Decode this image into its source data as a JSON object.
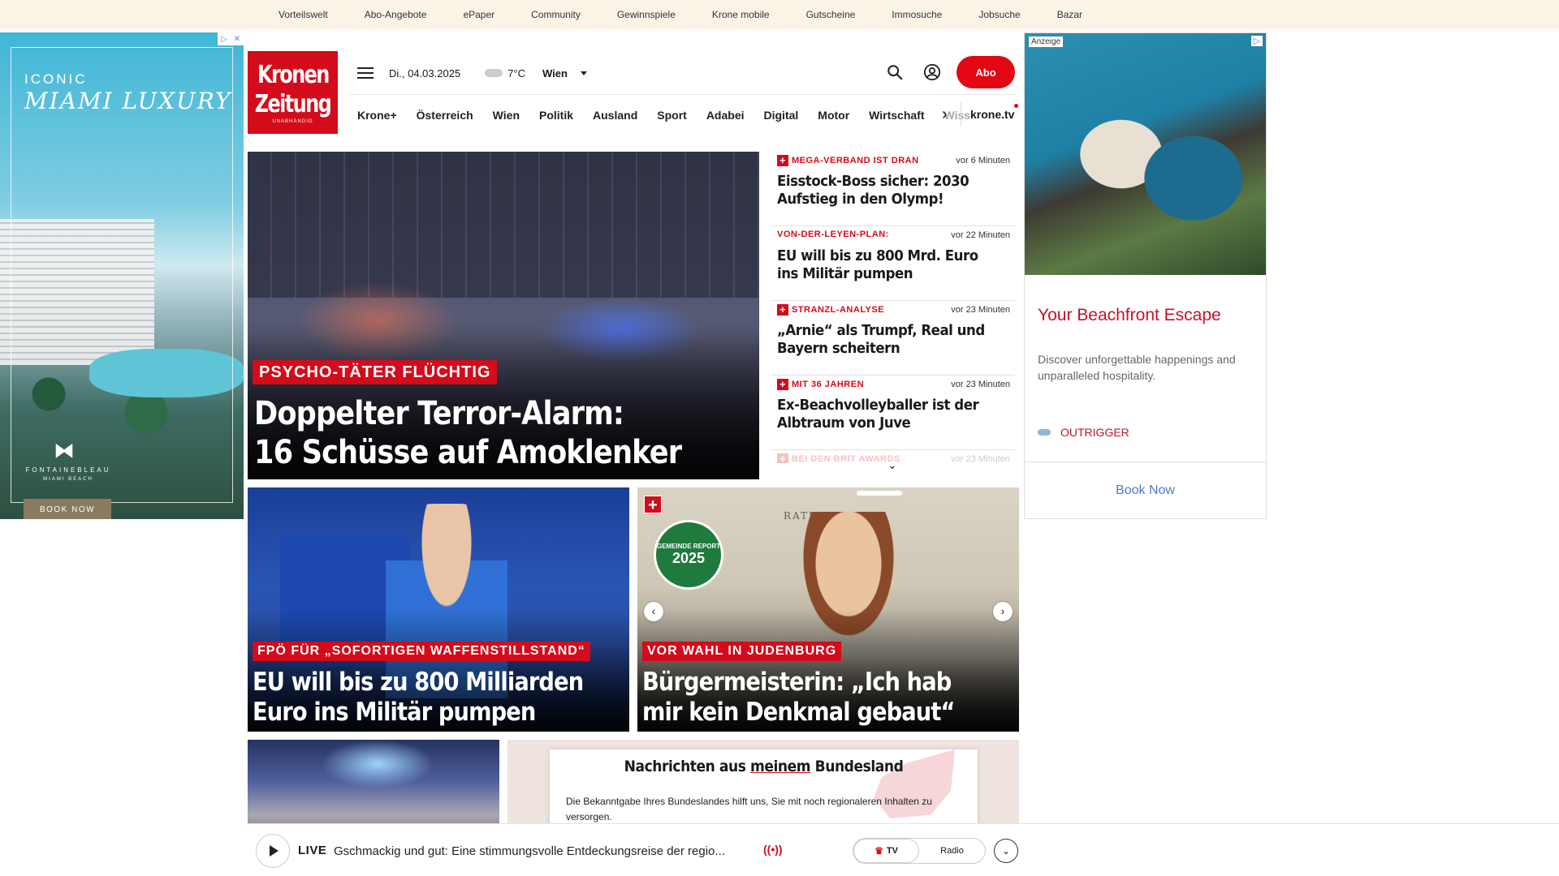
{
  "topnav": [
    "Vorteilswelt",
    "Abo-Angebote",
    "ePaper",
    "Community",
    "Gewinnspiele",
    "Krone mobile",
    "Gutscheine",
    "Immosuche",
    "Jobsuche",
    "Bazar"
  ],
  "ad_left": {
    "line1": "ICONIC",
    "line2": "MIAMI LUXURY",
    "brand": "FONTAINEBLEAU",
    "brand_sub": "MIAMI BEACH",
    "cta": "BOOK NOW",
    "icon": "ad-choices-icon"
  },
  "logo": {
    "line1": "Kronen",
    "line2": "Zeitung",
    "line3": "UNABHÄNGIG"
  },
  "header": {
    "date": "Di., 04.03.2025",
    "temperature": "7°C",
    "city": "Wien",
    "abo_label": "Abo"
  },
  "nav": [
    "Krone+",
    "Österreich",
    "Wien",
    "Politik",
    "Ausland",
    "Sport",
    "Adabei",
    "Digital",
    "Motor",
    "Wirtschaft"
  ],
  "nav_fade": "Wiss",
  "nav_tv": "krone.tv",
  "hero": {
    "tag": "PSYCHO-TÄTER FLÜCHTIG",
    "title_line1": "Doppelter Terror-Alarm:",
    "title_line2": "16 Schüsse auf Amoklenker"
  },
  "newslist": [
    {
      "plus": true,
      "kicker": "MEGA-VERBAND IST DRAN",
      "time": "vor 6 Minuten",
      "title": "Eisstock-Boss sicher: 2030 Aufstieg in den Olymp!"
    },
    {
      "plus": false,
      "kicker": "VON-DER-LEYEN-PLAN:",
      "time": "vor 22 Minuten",
      "title": "EU will bis zu 800 Mrd. Euro ins Militär pumpen"
    },
    {
      "plus": true,
      "kicker": "STRANZL-ANALYSE",
      "time": "vor 23 Minuten",
      "title": "„Arnie“ als Trumpf, Real und Bayern scheitern"
    },
    {
      "plus": true,
      "kicker": "MIT 36 JAHREN",
      "time": "vor 23 Minuten",
      "title": "Ex-Beachvolleyballer ist der Albtraum von Juve"
    },
    {
      "plus": true,
      "kicker": "BEI DEN BRIT AWARDS",
      "time": "vor 23 Minuten",
      "title": ""
    }
  ],
  "card1": {
    "tag": "FPÖ FÜR „SOFORTIGEN WAFFENSTILLSTAND“",
    "title_line1": "EU will bis zu 800 Milliarden",
    "title_line2": "Euro ins Militär pumpen"
  },
  "card2": {
    "badge_top": "GEMEINDE REPORT",
    "badge_year": "2025",
    "sign": "RATHAUS",
    "tag": "VOR WAHL IN JUDENBURG",
    "title_line1": "Bürgermeisterin: „Ich hab",
    "title_line2": "mir kein Denkmal gebaut“"
  },
  "popup": {
    "title_pre": "Nachrichten aus ",
    "title_underlined": "meinem",
    "title_post": " Bundesland",
    "text": "Die Bekanntgabe Ihres Bundeslandes hilft uns, Sie mit noch regionaleren Inhalten zu versorgen."
  },
  "livebar": {
    "label": "LIVE",
    "text": "Gschmackig und gut: Eine stimmungsvolle Entdeckungsreise der regio...",
    "tv_label": "TV",
    "radio_label": "Radio"
  },
  "ad_right": {
    "anzeige": "Anzeige",
    "headline": "Your Beachfront Escape",
    "description": "Discover unforgettable happenings and unparalleled hospitality.",
    "brand": "OUTRIGGER",
    "cta": "Book Now"
  },
  "colors": {
    "brand_red": "#d40b1a",
    "abo_red": "#e30613",
    "topbar_bg": "#fbf4e6"
  }
}
